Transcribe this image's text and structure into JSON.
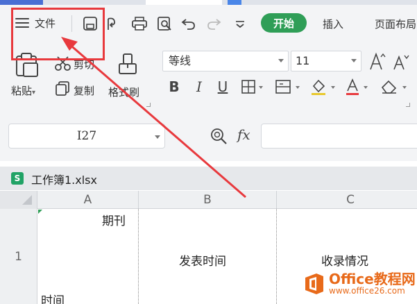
{
  "quick_access": {
    "menu_label": "文件",
    "icons": [
      "save-icon",
      "share-icon",
      "print-icon",
      "print-preview-icon",
      "undo-icon",
      "redo-icon",
      "customize-dropdown-icon"
    ]
  },
  "tabs": {
    "active": "开始",
    "insert": "插入",
    "page_layout": "页面布局"
  },
  "clipboard": {
    "paste": "粘贴",
    "cut": "剪切",
    "copy": "复制",
    "format_painter": "格式刷"
  },
  "font": {
    "name": "等线",
    "size": "11"
  },
  "formula_bar": {
    "cell_ref": "I27",
    "fx": "fx",
    "formula": ""
  },
  "workbook": {
    "icon_letter": "S",
    "name": "工作簿1.xlsx"
  },
  "sheet": {
    "columns": [
      "A",
      "B",
      "C"
    ],
    "rows": [
      {
        "number": "1",
        "cells": {
          "A_top": "期刊",
          "A_bottom": "时间",
          "B": "发表时间",
          "C": "收录情况"
        }
      }
    ]
  },
  "watermark": {
    "name": "Office教程网",
    "url": "www.office26.com"
  },
  "colors": {
    "start_tab": "#2f9e57",
    "annotation": "#e8393d",
    "watermark": "#e86a1a",
    "font_color_underline": "#e8393d"
  }
}
